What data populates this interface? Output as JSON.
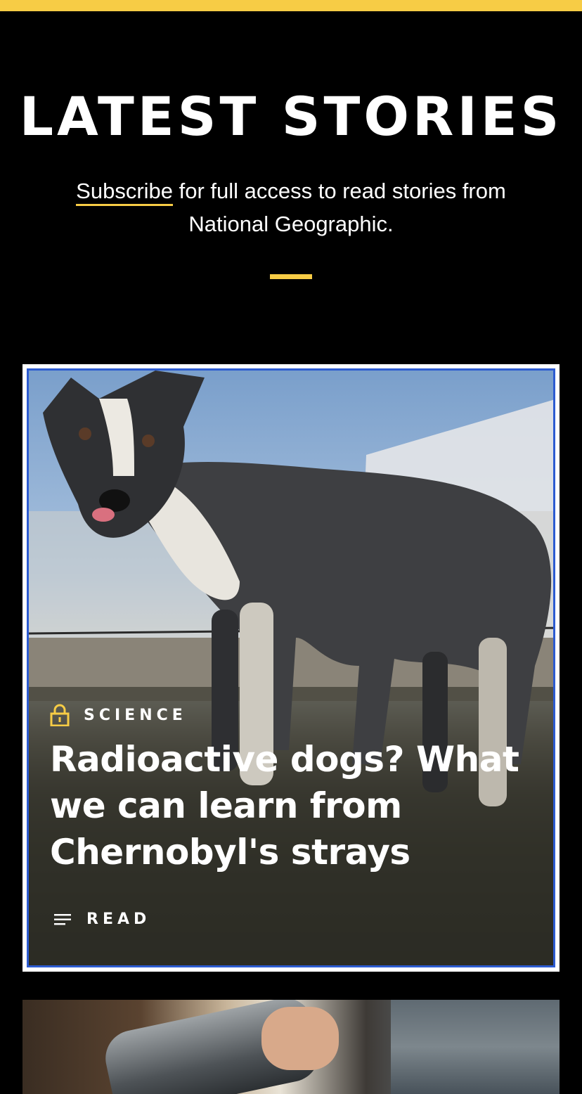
{
  "header": {
    "title": "LATEST STORIES",
    "subscribe_link": "Subscribe",
    "subscribe_rest": " for full access to read stories from National Geographic."
  },
  "stories": [
    {
      "category": "SCIENCE",
      "locked": true,
      "title": "Radioactive dogs? What we can learn from Chernobyl's strays",
      "action_label": "READ",
      "icon": "lock-icon"
    }
  ],
  "colors": {
    "accent": "#f7cc45",
    "background": "#000000",
    "focus_outline": "#2c5bd1"
  }
}
